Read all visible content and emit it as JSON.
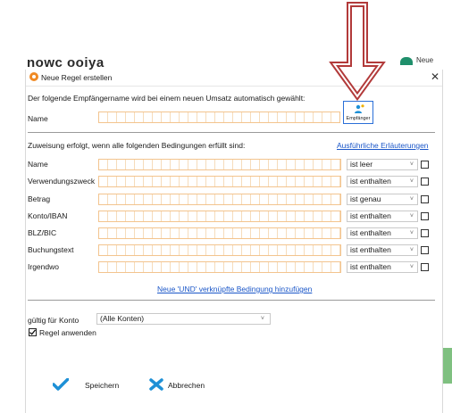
{
  "background": {
    "title_fragment": "nowc ooiya",
    "right_tab_fragment": "Neue"
  },
  "dialog": {
    "title": "Neue Regel erstellen",
    "close_glyph": "✕",
    "intro": "Der folgende Empfängername wird bei einem neuen Umsatz automatisch gewählt:",
    "name_label": "Name",
    "name_value": "",
    "empfaenger_button_label": "Empfänger",
    "conditions_intro": "Zuweisung erfolgt, wenn alle folgenden Bedingungen erfüllt sind:",
    "help_link": "Ausführliche Erläuterungen",
    "conditions": [
      {
        "label": "Name",
        "value": "",
        "operator": "ist leer",
        "checked": false
      },
      {
        "label": "Verwendungszweck",
        "value": "",
        "operator": "ist enthalten",
        "checked": false
      },
      {
        "label": "Betrag",
        "value": "",
        "operator": "ist genau",
        "checked": false
      },
      {
        "label": "Konto/IBAN",
        "value": "",
        "operator": "ist enthalten",
        "checked": false
      },
      {
        "label": "BLZ/BIC",
        "value": "",
        "operator": "ist enthalten",
        "checked": false
      },
      {
        "label": "Buchungstext",
        "value": "",
        "operator": "ist enthalten",
        "checked": false
      },
      {
        "label": "Irgendwo",
        "value": "",
        "operator": "ist enthalten",
        "checked": false
      }
    ],
    "add_condition_link": "Neue 'UND' verknüpfte Bedingung hinzufügen",
    "account_label": "gültig für Konto",
    "account_value": "(Alle Konten)",
    "apply_rule_label": "Regel anwenden",
    "apply_rule_checked": true,
    "save_label": "Speichern",
    "cancel_label": "Abbrechen",
    "chevron_glyph": "˅"
  },
  "colors": {
    "accent": "#1a56c8",
    "field_border": "#f3c48e",
    "arrow_fill": "#b23a3a",
    "save_icon": "#1e90d6",
    "cancel_icon": "#1e90d6"
  }
}
